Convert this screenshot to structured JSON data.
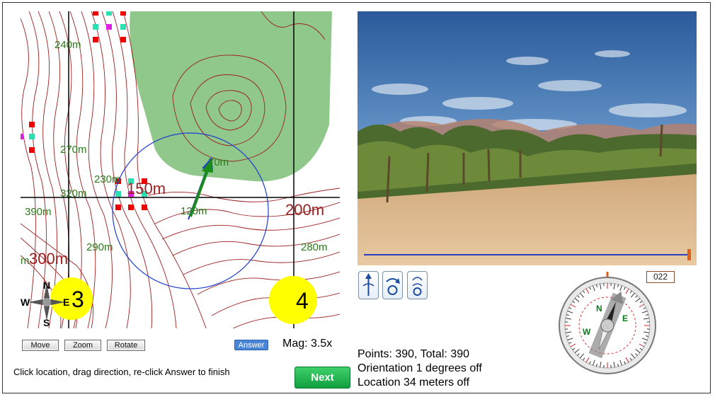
{
  "map": {
    "contour_labels": [
      "240m",
      "270m",
      "230m",
      "320m",
      "150m",
      "390m",
      "70m",
      "120m",
      "200m",
      "290m",
      "280m",
      "300m",
      "m"
    ],
    "grid_numbers": [
      "3",
      "4"
    ],
    "compass_rose": {
      "n": "N",
      "s": "S",
      "e": "E",
      "w": "W"
    },
    "colors": {
      "contour": "#9c1f1f",
      "vegetation": "#8fc88a",
      "target_circle": "#1f3fd0",
      "arrow": "#1a8a1a",
      "grid": "#000000",
      "marker_yellow": "#ffff00"
    }
  },
  "map_controls": {
    "move": "Move",
    "zoom": "Zoom",
    "rotate": "Rotate"
  },
  "answer_button": "Answer",
  "magnification": "Mag: 3.5x",
  "instructions": "Click location, drag direction, re-click Answer to finish",
  "next_button": "Next",
  "results": {
    "points": "Points: 390, Total: 390",
    "orientation": "Orientation 1 degrees off",
    "location": "Location 34 meters off"
  },
  "scene_controls": [
    "forward-icon",
    "turn-icon",
    "look-down-icon"
  ],
  "heading_readout": "022",
  "compass_dial": {
    "n": "N",
    "e": "E",
    "w": "W"
  }
}
